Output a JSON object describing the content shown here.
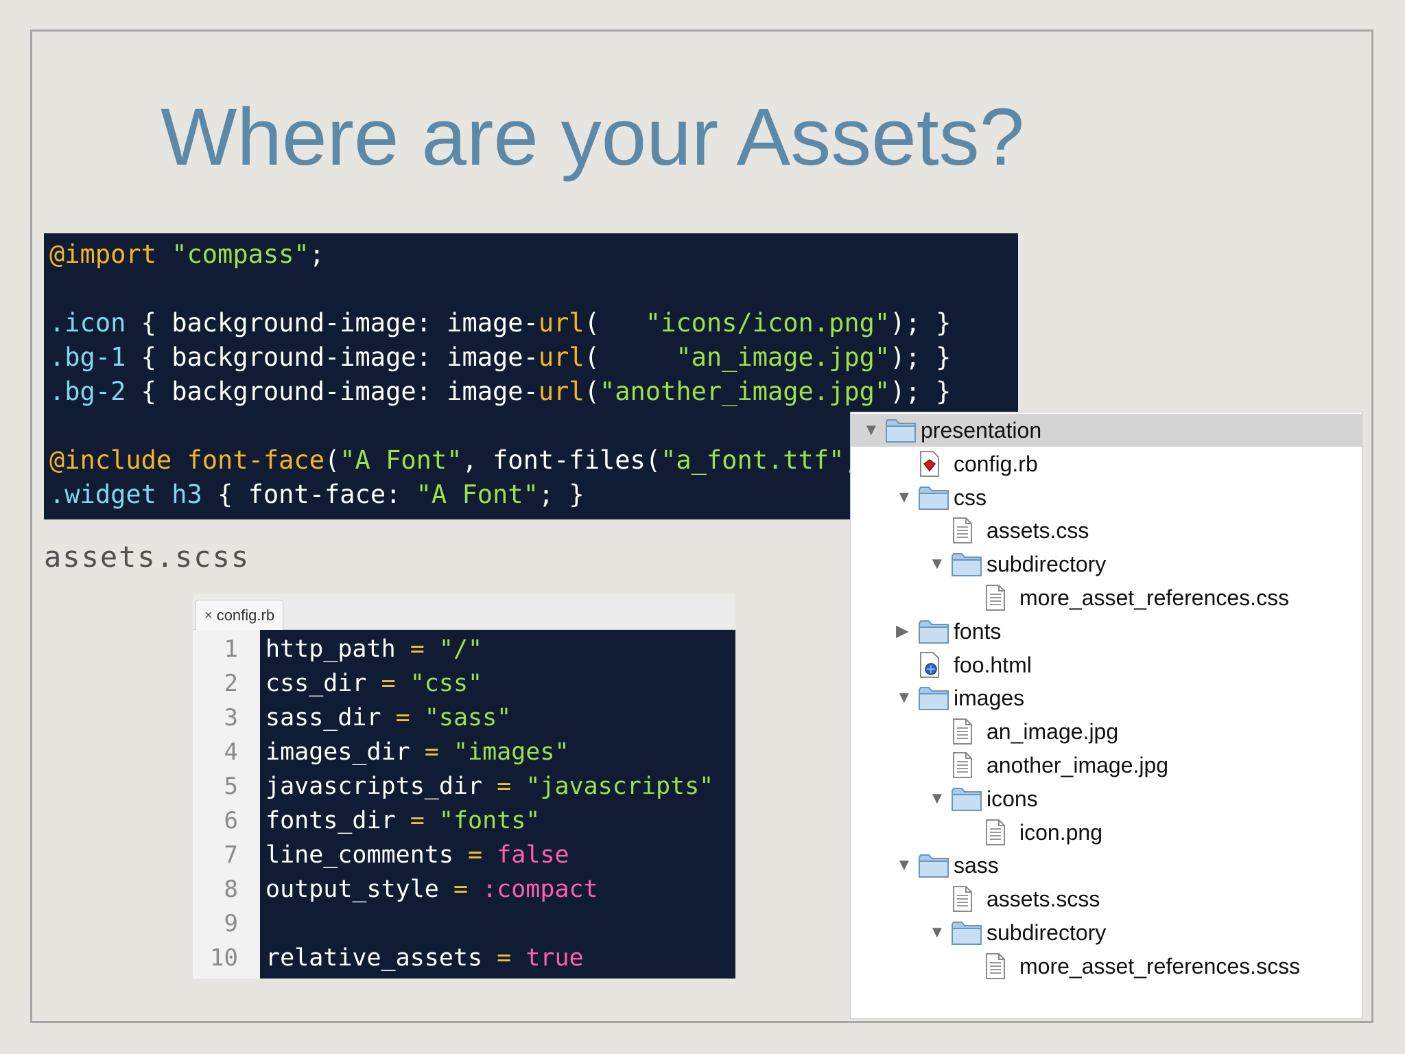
{
  "slide": {
    "title": "Where are your Assets?"
  },
  "scss_code": {
    "caption": "assets.scss",
    "lines": [
      [
        {
          "t": "@import",
          "c": "c-at"
        },
        {
          "t": " "
        },
        {
          "t": "\"compass\"",
          "c": "c-str"
        },
        {
          "t": ";"
        }
      ],
      [],
      [
        {
          "t": ".icon",
          "c": "c-sel"
        },
        {
          "t": " { background-image: image-"
        },
        {
          "t": "url",
          "c": "c-fn"
        },
        {
          "t": "(   "
        },
        {
          "t": "\"icons/icon.png\"",
          "c": "c-str"
        },
        {
          "t": "); }"
        }
      ],
      [
        {
          "t": ".bg-1",
          "c": "c-sel"
        },
        {
          "t": " { background-image: image-"
        },
        {
          "t": "url",
          "c": "c-fn"
        },
        {
          "t": "(     "
        },
        {
          "t": "\"an_image.jpg\"",
          "c": "c-str"
        },
        {
          "t": "); }"
        }
      ],
      [
        {
          "t": ".bg-2",
          "c": "c-sel"
        },
        {
          "t": " { background-image: image-"
        },
        {
          "t": "url",
          "c": "c-fn"
        },
        {
          "t": "("
        },
        {
          "t": "\"another_image.jpg\"",
          "c": "c-str"
        },
        {
          "t": "); }"
        }
      ],
      [],
      [
        {
          "t": "@include",
          "c": "c-at"
        },
        {
          "t": " "
        },
        {
          "t": "font-face",
          "c": "c-fn"
        },
        {
          "t": "("
        },
        {
          "t": "\"A Font\"",
          "c": "c-str"
        },
        {
          "t": ", font-files("
        },
        {
          "t": "\"a_font.ttf\"",
          "c": "c-str"
        },
        {
          "t": ", "
        }
      ],
      [
        {
          "t": ".widget",
          "c": "c-sel"
        },
        {
          "t": " "
        },
        {
          "t": "h3",
          "c": "c-sel"
        },
        {
          "t": " { font-face: "
        },
        {
          "t": "\"A Font\"",
          "c": "c-str"
        },
        {
          "t": "; }"
        }
      ]
    ]
  },
  "config_editor": {
    "tab_label": "config.rb",
    "close_glyph": "×",
    "lines": [
      {
        "n": "1",
        "parts": [
          {
            "t": "http_path "
          },
          {
            "t": "=",
            "c": "c-op"
          },
          {
            "t": " "
          },
          {
            "t": "\"/\"",
            "c": "c-str"
          }
        ]
      },
      {
        "n": "2",
        "parts": [
          {
            "t": "css_dir "
          },
          {
            "t": "=",
            "c": "c-op"
          },
          {
            "t": " "
          },
          {
            "t": "\"css\"",
            "c": "c-str"
          }
        ]
      },
      {
        "n": "3",
        "parts": [
          {
            "t": "sass_dir "
          },
          {
            "t": "=",
            "c": "c-op"
          },
          {
            "t": " "
          },
          {
            "t": "\"sass\"",
            "c": "c-str"
          }
        ]
      },
      {
        "n": "4",
        "parts": [
          {
            "t": "images_dir "
          },
          {
            "t": "=",
            "c": "c-op"
          },
          {
            "t": " "
          },
          {
            "t": "\"images\"",
            "c": "c-str"
          }
        ]
      },
      {
        "n": "5",
        "parts": [
          {
            "t": "javascripts_dir "
          },
          {
            "t": "=",
            "c": "c-op"
          },
          {
            "t": " "
          },
          {
            "t": "\"javascripts\"",
            "c": "c-str"
          }
        ]
      },
      {
        "n": "6",
        "parts": [
          {
            "t": "fonts_dir "
          },
          {
            "t": "=",
            "c": "c-op"
          },
          {
            "t": " "
          },
          {
            "t": "\"fonts\"",
            "c": "c-str"
          }
        ]
      },
      {
        "n": "7",
        "parts": [
          {
            "t": "line_comments "
          },
          {
            "t": "=",
            "c": "c-op"
          },
          {
            "t": " "
          },
          {
            "t": "false",
            "c": "c-pink"
          }
        ]
      },
      {
        "n": "8",
        "parts": [
          {
            "t": "output_style "
          },
          {
            "t": "=",
            "c": "c-op"
          },
          {
            "t": " "
          },
          {
            "t": ":compact",
            "c": "c-pink"
          }
        ]
      },
      {
        "n": "9",
        "parts": []
      },
      {
        "n": "10",
        "parts": [
          {
            "t": "relative_assets "
          },
          {
            "t": "=",
            "c": "c-op"
          },
          {
            "t": " "
          },
          {
            "t": "true",
            "c": "c-pink"
          }
        ]
      }
    ]
  },
  "file_tree": {
    "items": [
      {
        "label": "presentation",
        "depth": 0,
        "type": "folder",
        "state": "expanded",
        "selected": true
      },
      {
        "label": "config.rb",
        "depth": 1,
        "type": "ruby-file"
      },
      {
        "label": "css",
        "depth": 1,
        "type": "folder",
        "state": "expanded"
      },
      {
        "label": "assets.css",
        "depth": 2,
        "type": "text-file"
      },
      {
        "label": "subdirectory",
        "depth": 2,
        "type": "folder",
        "state": "expanded"
      },
      {
        "label": "more_asset_references.css",
        "depth": 3,
        "type": "text-file"
      },
      {
        "label": "fonts",
        "depth": 1,
        "type": "folder",
        "state": "collapsed"
      },
      {
        "label": "foo.html",
        "depth": 1,
        "type": "html-file"
      },
      {
        "label": "images",
        "depth": 1,
        "type": "folder",
        "state": "expanded"
      },
      {
        "label": "an_image.jpg",
        "depth": 2,
        "type": "text-file"
      },
      {
        "label": "another_image.jpg",
        "depth": 2,
        "type": "text-file"
      },
      {
        "label": "icons",
        "depth": 2,
        "type": "folder",
        "state": "expanded"
      },
      {
        "label": "icon.png",
        "depth": 3,
        "type": "text-file"
      },
      {
        "label": "sass",
        "depth": 1,
        "type": "folder",
        "state": "expanded"
      },
      {
        "label": "assets.scss",
        "depth": 2,
        "type": "text-file"
      },
      {
        "label": "subdirectory",
        "depth": 2,
        "type": "folder",
        "state": "expanded"
      },
      {
        "label": "more_asset_references.scss",
        "depth": 3,
        "type": "text-file"
      }
    ]
  },
  "colors": {
    "title": "#5d89a8",
    "code_bg": "#0f1c33",
    "string": "#9fe04a",
    "keyword": "#f7b525",
    "selector": "#84d6ef",
    "literal": "#ff5ea8"
  }
}
